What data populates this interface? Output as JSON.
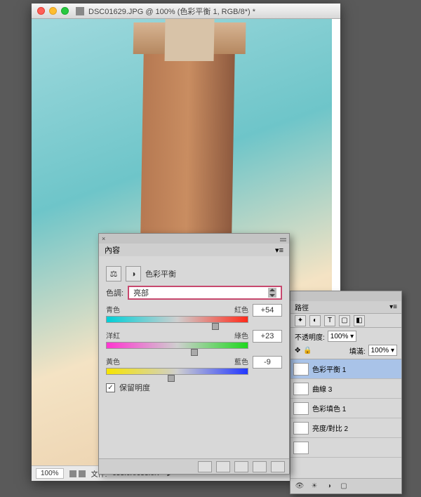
{
  "window": {
    "title": "DSC01629.JPG @ 100% (色彩平衡 1, RGB/8*) *"
  },
  "statusbar": {
    "zoom": "100%",
    "doc_label": "文件:",
    "doc_size": "953.6K/953.6K"
  },
  "panel": {
    "tab": "內容",
    "title": "色彩平衡",
    "tone_label": "色調:",
    "tone_value": "亮部",
    "sliders": {
      "cr": {
        "left": "青色",
        "right": "紅色",
        "value": "+54",
        "pos": 77
      },
      "mg": {
        "left": "洋紅",
        "right": "綠色",
        "value": "+23",
        "pos": 62
      },
      "yb": {
        "left": "黃色",
        "right": "藍色",
        "value": "-9",
        "pos": 46
      }
    },
    "preserve": "保留明度"
  },
  "layers": {
    "tab_paths": "路徑",
    "opacity_label": "不透明度:",
    "opacity_value": "100%",
    "fill_label": "填滿:",
    "fill_value": "100%",
    "items": [
      {
        "name": "色彩平衡 1",
        "active": true
      },
      {
        "name": "曲線 3",
        "active": false
      },
      {
        "name": "色彩填色 1",
        "active": false
      },
      {
        "name": "亮度/對比 2",
        "active": false
      }
    ]
  }
}
